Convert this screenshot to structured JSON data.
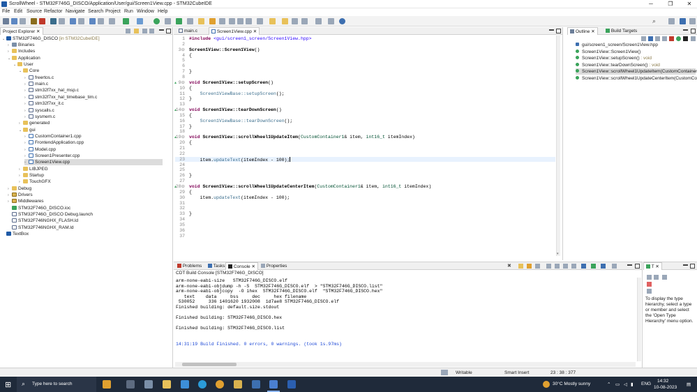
{
  "window": {
    "title": "ScrollWheel - STM32F746G_DISCO/Application/User/gui/Screen1View.cpp - STM32CubeIDE",
    "minimize": "─",
    "maximize": "❐",
    "close": "✕"
  },
  "menu": [
    "File",
    "Edit",
    "Source",
    "Refactor",
    "Navigate",
    "Search",
    "Project",
    "Run",
    "Window",
    "Help"
  ],
  "project_explorer": {
    "tab_label": "Project Explorer",
    "project_name": "STM32F746G_DISCO",
    "project_suffix": "[in STM32CubeIDE]",
    "items": [
      {
        "label": "Binaries",
        "depth": 1,
        "kind": "bin",
        "arrow": "›"
      },
      {
        "label": "Includes",
        "depth": 1,
        "kind": "folder",
        "arrow": "›"
      },
      {
        "label": "Application",
        "depth": 1,
        "kind": "folder",
        "arrow": "⌄"
      },
      {
        "label": "User",
        "depth": 2,
        "kind": "folder",
        "arrow": "⌄"
      },
      {
        "label": "Core",
        "depth": 3,
        "kind": "folder",
        "arrow": "⌄"
      },
      {
        "label": "freertos.c",
        "depth": 4,
        "kind": "file",
        "arrow": "›"
      },
      {
        "label": "main.c",
        "depth": 4,
        "kind": "file",
        "arrow": "›"
      },
      {
        "label": "stm32f7xx_hal_msp.c",
        "depth": 4,
        "kind": "file",
        "arrow": "›"
      },
      {
        "label": "stm32f7xx_hal_timebase_tim.c",
        "depth": 4,
        "kind": "file",
        "arrow": "›"
      },
      {
        "label": "stm32f7xx_it.c",
        "depth": 4,
        "kind": "file",
        "arrow": "›"
      },
      {
        "label": "syscalls.c",
        "depth": 4,
        "kind": "file",
        "arrow": "›"
      },
      {
        "label": "sysmem.c",
        "depth": 4,
        "kind": "file",
        "arrow": "›"
      },
      {
        "label": "generated",
        "depth": 3,
        "kind": "folder",
        "arrow": "›"
      },
      {
        "label": "gui",
        "depth": 3,
        "kind": "folder",
        "arrow": "⌄"
      },
      {
        "label": "CustomContainer1.cpp",
        "depth": 4,
        "kind": "cpp",
        "arrow": "›"
      },
      {
        "label": "FrontendApplication.cpp",
        "depth": 4,
        "kind": "cpp",
        "arrow": "›"
      },
      {
        "label": "Model.cpp",
        "depth": 4,
        "kind": "cpp",
        "arrow": "›"
      },
      {
        "label": "Screen1Presenter.cpp",
        "depth": 4,
        "kind": "cpp",
        "arrow": "›"
      },
      {
        "label": "Screen1View.cpp",
        "depth": 4,
        "kind": "cpp",
        "arrow": "›",
        "selected": true
      },
      {
        "label": "LIBJPEG",
        "depth": 3,
        "kind": "folder",
        "arrow": "›"
      },
      {
        "label": "Startup",
        "depth": 3,
        "kind": "folder",
        "arrow": "›"
      },
      {
        "label": "TouchGFX",
        "depth": 3,
        "kind": "folder",
        "arrow": "›"
      },
      {
        "label": "Debug",
        "depth": 1,
        "kind": "folder",
        "arrow": "›"
      },
      {
        "label": "Drivers",
        "depth": 1,
        "kind": "src",
        "arrow": "›"
      },
      {
        "label": "Middlewares",
        "depth": 1,
        "kind": "src",
        "arrow": "›"
      },
      {
        "label": "STM32F746G_DISCO.ioc",
        "depth": 1,
        "kind": "cfg",
        "arrow": ""
      },
      {
        "label": "STM32F746G_DISCO Debug.launch",
        "depth": 1,
        "kind": "file",
        "arrow": ""
      },
      {
        "label": "STM32F746NGHX_FLASH.ld",
        "depth": 1,
        "kind": "file",
        "arrow": ""
      },
      {
        "label": "STM32F746NGHX_RAM.ld",
        "depth": 1,
        "kind": "file",
        "arrow": ""
      }
    ],
    "extra_project": "TextBox"
  },
  "editor": {
    "tabs": [
      {
        "label": "main.c",
        "active": false
      },
      {
        "label": "Screen1View.cpp",
        "active": true
      }
    ],
    "lines": [
      {
        "n": "1",
        "html": "<span class=\"kw\">#include</span> <span class=\"str\">&lt;gui/screen1_screen/Screen1View.hpp&gt;</span>"
      },
      {
        "n": "2",
        "html": ""
      },
      {
        "n": "3⊖",
        "html": "<span class=\"fn\">Screen1View::Screen1View</span>()"
      },
      {
        "n": "4",
        "html": "{"
      },
      {
        "n": "5",
        "html": ""
      },
      {
        "n": "6",
        "html": ""
      },
      {
        "n": "7",
        "html": "}"
      },
      {
        "n": "8",
        "html": ""
      },
      {
        "n": "9⊖",
        "html": "<span class=\"kw\">void</span> <span class=\"fn\">Screen1View::setupScreen</span>()",
        "marker": true
      },
      {
        "n": "10",
        "html": "{"
      },
      {
        "n": "11",
        "html": "    <span class=\"call\">Screen1ViewBase::setupScreen</span>();"
      },
      {
        "n": "12",
        "html": "}"
      },
      {
        "n": "13",
        "html": ""
      },
      {
        "n": "14⊖",
        "html": "<span class=\"kw\">void</span> <span class=\"fn\">Screen1View::tearDownScreen</span>()",
        "marker": true
      },
      {
        "n": "15",
        "html": "{"
      },
      {
        "n": "16",
        "html": "    <span class=\"call\">Screen1ViewBase::tearDownScreen</span>();"
      },
      {
        "n": "17",
        "html": "}"
      },
      {
        "n": "18",
        "html": ""
      },
      {
        "n": "19⊖",
        "html": "<span class=\"kw\">void</span> <span class=\"fn\">Screen1View::scrollWheel1UpdateItem</span>(<span class=\"type\">CustomContainer1</span>&amp; item, <span class=\"type\">int16_t</span> itemIndex)",
        "marker": true
      },
      {
        "n": "20",
        "html": "{"
      },
      {
        "n": "21",
        "html": ""
      },
      {
        "n": "22",
        "html": ""
      },
      {
        "n": "23",
        "html": "    item.<span class=\"call\">updateText</span>(itemIndex - 100);",
        "highlight": true
      },
      {
        "n": "24",
        "html": ""
      },
      {
        "n": "25",
        "html": ""
      },
      {
        "n": "26",
        "html": "}"
      },
      {
        "n": "27",
        "html": ""
      },
      {
        "n": "28⊖",
        "html": "<span class=\"kw\">void</span> <span class=\"fn\">Screen1View::scrollWheel1UpdateCenterItem</span>(<span class=\"type\">CustomContainer1</span>&amp; item, <span class=\"type\">int16_t</span> itemIndex)",
        "marker": true
      },
      {
        "n": "29",
        "html": "{"
      },
      {
        "n": "30",
        "html": "    item.<span class=\"call\">updateText</span>(itemIndex - 100);"
      },
      {
        "n": "31",
        "html": ""
      },
      {
        "n": "32",
        "html": ""
      },
      {
        "n": "33",
        "html": "}"
      },
      {
        "n": "34",
        "html": ""
      },
      {
        "n": "35",
        "html": ""
      },
      {
        "n": "36",
        "html": ""
      },
      {
        "n": "37",
        "html": ""
      }
    ]
  },
  "outline": {
    "tabs": [
      {
        "label": "Outline",
        "active": true
      },
      {
        "label": "Build Targets",
        "active": false
      }
    ],
    "items": [
      {
        "label": "gui/screen1_screen/Screen1View.hpp",
        "suffix": "",
        "kind": "inc"
      },
      {
        "label": "Screen1View::Screen1View()",
        "suffix": "",
        "kind": "fn"
      },
      {
        "label": "Screen1View::setupScreen()",
        "suffix": " : void",
        "kind": "fn"
      },
      {
        "label": "Screen1View::tearDownScreen()",
        "suffix": " : void",
        "kind": "fn"
      },
      {
        "label": "Screen1View::scrollWheel1UpdateItem(CustomContainer1",
        "suffix": "",
        "kind": "fn",
        "selected": true
      },
      {
        "label": "Screen1View::scrollWheel1UpdateCenterItem(CustomCont",
        "suffix": "",
        "kind": "fn"
      }
    ]
  },
  "console": {
    "tabs": [
      {
        "label": "Problems",
        "active": false
      },
      {
        "label": "Tasks",
        "active": false
      },
      {
        "label": "Console",
        "active": true
      },
      {
        "label": "Properties",
        "active": false
      }
    ],
    "header": "CDT Build Console [STM32F746G_DISCO]",
    "lines": [
      {
        "text": "arm-none-eabi-size   STM32F746G_DISCO.elf"
      },
      {
        "text": "arm-none-eabi-objdump -h -S  STM32F746G_DISCO.elf  > \"STM32F746G_DISCO.list\""
      },
      {
        "text": "arm-none-eabi-objcopy  -O ihex  STM32F746G_DISCO.elf  \"STM32F746G_DISCO.hex\""
      },
      {
        "text": "   text    data     bss     dec     hex filename"
      },
      {
        "text": " 530052     336 1401620 1932008  1d7ae8 STM32F746G_DISCO.elf"
      },
      {
        "text": "Finished building: default.size.stdout"
      },
      {
        "text": ""
      },
      {
        "text": "Finished building: STM32F746G_DISCO.hex"
      },
      {
        "text": ""
      },
      {
        "text": "Finished building: STM32F746G_DISCO.list"
      },
      {
        "text": ""
      },
      {
        "text": ""
      },
      {
        "text": "14:31:19 Build Finished. 0 errors, 0 warnings. (took 1s.97ms)",
        "blue": true
      }
    ]
  },
  "type_hierarchy": {
    "tab_label": "T",
    "message": "To display the type hierarchy, select a type or member and select the 'Open Type Hierarchy' menu option."
  },
  "status": {
    "writable": "Writable",
    "insert_mode": "Smart Insert",
    "position": "23 : 38 : 377"
  },
  "taskbar": {
    "search_placeholder": "Type here to search",
    "weather": "30°C  Mostly sunny",
    "lang": "ENG",
    "time": "14:32",
    "date": "10-08-2023"
  }
}
